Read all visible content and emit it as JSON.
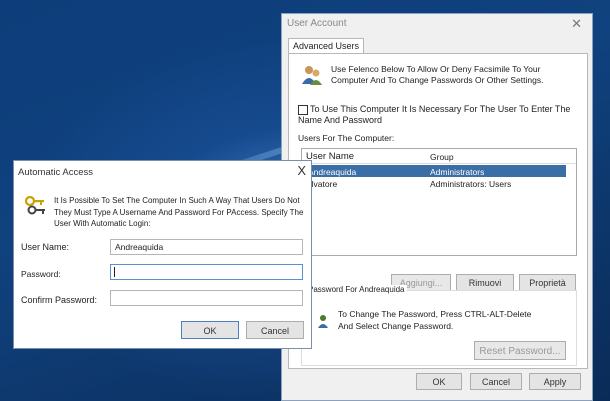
{
  "main_window": {
    "title": "User Account",
    "tab": "Advanced Users",
    "intro_text": "Use Felenco Below To Allow Or Deny Facsimile To Your Computer And To Change Passwords Or Other Settings.",
    "checkbox_label": "To Use This Computer It Is Necessary For The User To Enter The Name And Password",
    "users_label": "Users For The Computer:",
    "list": {
      "col_name": "User Name",
      "col_group": "Group",
      "rows": [
        {
          "name": "Andreaquida",
          "group": "Administrators",
          "selected": true
        },
        {
          "name": "Alvatore",
          "group": "Administrators: Users",
          "selected": false
        }
      ]
    },
    "buttons": {
      "add": "Aggiungi...",
      "remove": "Rimuovi",
      "properties": "Proprietà"
    },
    "password_group": {
      "legend": "Password For Andreaquida",
      "text": "To Change The Password, Press CTRL-ALT-Delete And Select Change Password.",
      "reset": "Reset Password..."
    },
    "footer": {
      "ok": "OK",
      "cancel": "Cancel",
      "apply": "Apply"
    }
  },
  "dialog": {
    "title": "Automatic Access",
    "close": "X",
    "description": "It Is Possible To Set The Computer In Such A Way That Users Do Not They Must Type A Username And Password For PAccess. Specify The User With Automatic Login:",
    "username_label": "User Name:",
    "username_value": "Andreaquida",
    "password_label": "Password:",
    "confirm_label": "Confirm Password:",
    "ok": "OK",
    "cancel": "Cancel"
  },
  "colors": {
    "selection": "#3a6ea5",
    "focus_border": "#5a8fd0",
    "desktop": "#0d3d7a"
  }
}
